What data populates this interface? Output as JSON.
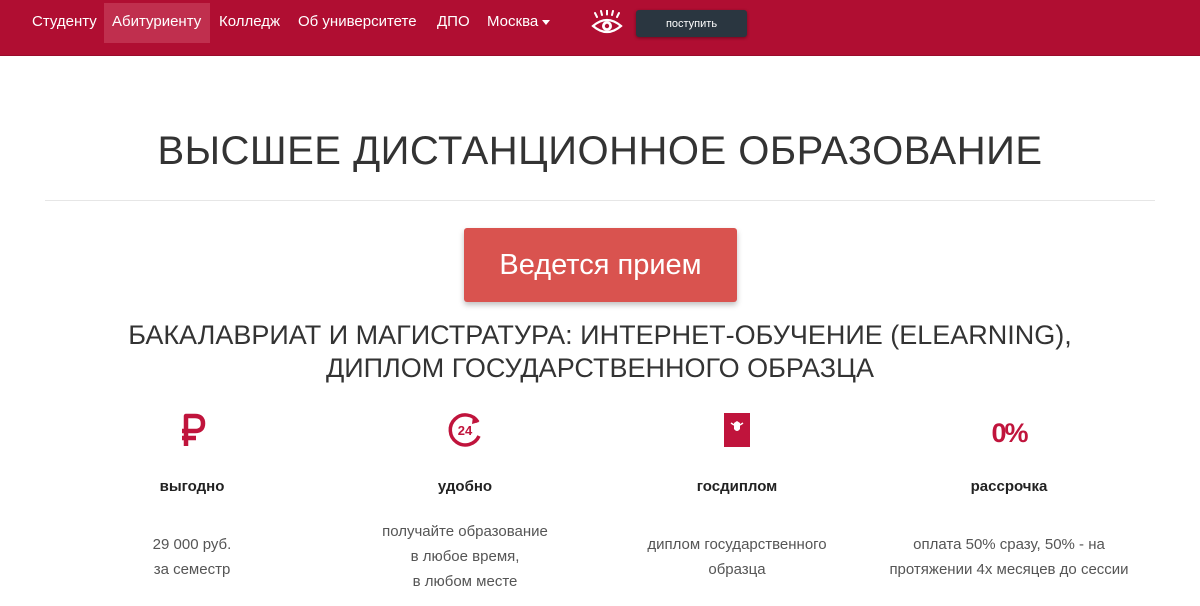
{
  "nav": {
    "items": [
      {
        "label": "Студенту"
      },
      {
        "label": "Абитуриенту"
      },
      {
        "label": "Колледж"
      },
      {
        "label": "Об университете"
      },
      {
        "label": "ДПО"
      },
      {
        "label": "Москва"
      }
    ],
    "active_item": "Абитуриенту",
    "vision_icon": "eye-icon",
    "apply_label": "поступить",
    "bg_color": "#b00e32"
  },
  "main": {
    "title": "ВЫСШЕЕ ДИСТАНЦИОННОЕ ОБРАЗОВАНИЕ",
    "cta_label": "Ведется прием",
    "cta_color": "#d9534f",
    "subtitle_lines": [
      "БАКАЛАВРИАТ И МАГИСТРАТУРА: ИНТЕРНЕТ-ОБУЧЕНИЕ (ELEARNING),",
      "ДИПЛОМ ГОСУДАРСТВЕННОГО ОБРАЗЦА"
    ]
  },
  "features": [
    {
      "icon": "ruble-icon",
      "title": "выгодно",
      "lines": [
        "29 000 руб.",
        "за семестр"
      ]
    },
    {
      "icon": "clock-24-icon",
      "title": "удобно",
      "lines": [
        "получайте образование",
        "в любое время,",
        "в любом месте"
      ]
    },
    {
      "icon": "diploma-icon",
      "title": "госдиплом",
      "lines": [
        "диплом государственного",
        "образца"
      ]
    },
    {
      "icon": "zero-percent-icon",
      "title": "рассрочка",
      "lines": [
        "оплата 50% сразу, 50% - на",
        "протяжении 4х месяцев до сессии"
      ]
    }
  ],
  "accent_color": "#c0143c"
}
